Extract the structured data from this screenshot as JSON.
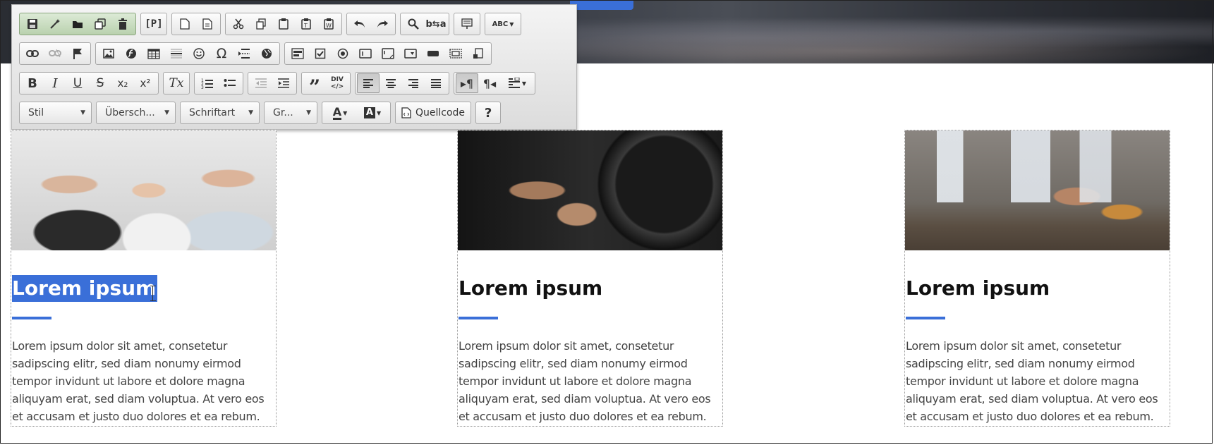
{
  "colors": {
    "accent": "#3a6fd8",
    "toolbar_bg": "#e6e6e6",
    "text": "#444444"
  },
  "toolbar": {
    "row1": {
      "document_group": [
        "save-icon",
        "magic-wand-icon",
        "folder-open-icon",
        "copy-document-icon",
        "trash-icon"
      ],
      "p_button_label": "[P]",
      "page_group": [
        "new-page-icon",
        "template-icon"
      ],
      "clipboard_group": [
        "cut-icon",
        "copy-icon",
        "paste-icon",
        "paste-text-icon",
        "paste-word-icon"
      ],
      "undo_group": [
        "undo-icon",
        "redo-icon"
      ],
      "find_group": [
        "find-icon",
        "replace-icon"
      ],
      "select_all_icon": "select-all-icon",
      "spellcheck_label": "ABC"
    },
    "row3": {
      "bold": "B",
      "italic": "I",
      "underline": "U",
      "strike": "S",
      "subscript": "x₂",
      "superscript": "x²",
      "remove_format": "Tx",
      "div_label": "DIV"
    },
    "row4": {
      "style_label": "Stil",
      "format_label": "Übersch...",
      "font_label": "Schriftart",
      "size_label": "Gr...",
      "source_label": "Quellcode",
      "help_label": "?"
    }
  },
  "cards": [
    {
      "image": "women-gym-photo",
      "title": "Lorem ipsum",
      "selected": true,
      "text": "Lorem ipsum dolor sit amet, consetetur sadipscing elitr, sed diam nonumy eirmod tempor invidunt ut labore et dolore magna aliquyam erat, sed diam voluptua. At vero eos et accusam et justo duo dolores et ea rebum."
    },
    {
      "image": "barbell-deadlift-photo",
      "title": "Lorem ipsum",
      "selected": false,
      "text": "Lorem ipsum dolor sit amet, consetetur sadipscing elitr, sed diam nonumy eirmod tempor invidunt ut labore et dolore magna aliquyam erat, sed diam voluptua. At vero eos et accusam et justo duo dolores et ea rebum."
    },
    {
      "image": "studio-workout-photo",
      "title": "Lorem ipsum",
      "selected": false,
      "text": "Lorem ipsum dolor sit amet, consetetur sadipscing elitr, sed diam nonumy eirmod tempor invidunt ut labore et dolore magna aliquyam erat, sed diam voluptua. At vero eos et accusam et justo duo dolores et ea rebum."
    }
  ]
}
